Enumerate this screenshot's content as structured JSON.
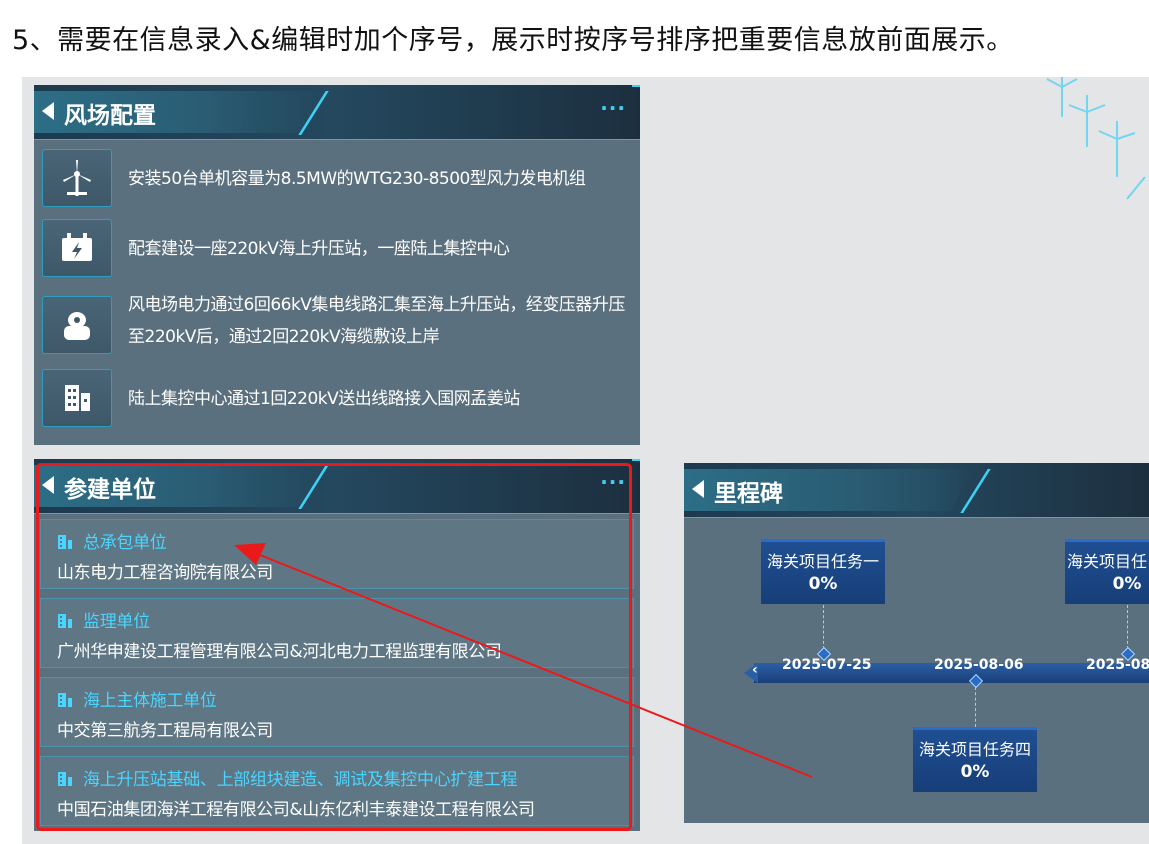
{
  "note": "5、需要在信息录入&编辑时加个序号，展示时按序号排序把重要信息放前面展示。",
  "wind_farm": {
    "title": "风场配置",
    "more": "···",
    "items": [
      {
        "icon": "wind-turbine-icon",
        "text": "安装50台单机容量为8.5MW的WTG230-8500型风力发电机组"
      },
      {
        "icon": "battery-charge-icon",
        "text": "配套建设一座220kV海上升压站，一座陆上集控中心"
      },
      {
        "icon": "transformer-icon",
        "text": "风电场电力通过6回66kV集电线路汇集至海上升压站，经变压器升压至220kV后，通过2回220kV海缆敷设上岸"
      },
      {
        "icon": "building-icon",
        "text": "陆上集控中心通过1回220kV送出线路接入国网孟姜站"
      }
    ]
  },
  "participants": {
    "title": "参建单位",
    "more": "···",
    "units": [
      {
        "role": "总承包单位",
        "name": "山东电力工程咨询院有限公司"
      },
      {
        "role": "监理单位",
        "name": "广州华申建设工程管理有限公司&河北电力工程监理有限公司"
      },
      {
        "role": "海上主体施工单位",
        "name": "中交第三航务工程局有限公司"
      },
      {
        "role": "海上升压站基础、上部组块建造、调试及集控中心扩建工程",
        "name": "中国石油集团海洋工程有限公司&山东亿利丰泰建设工程有限公司"
      }
    ]
  },
  "milestones": {
    "title": "里程碑",
    "dates": [
      "2025-07-25",
      "2025-08-06",
      "2025-08-"
    ],
    "tasks": [
      {
        "name": "海关项目任务一",
        "percent": "0%"
      },
      {
        "name": "海关项目任",
        "percent": "0%"
      },
      {
        "name": "海关项目任务四",
        "percent": "0%"
      }
    ]
  },
  "colors": {
    "accent": "#3fd0f4",
    "panel_bg": "#5b707f",
    "annotation_red": "#ea1a1a",
    "milestone_blue": "#1f4f92"
  }
}
